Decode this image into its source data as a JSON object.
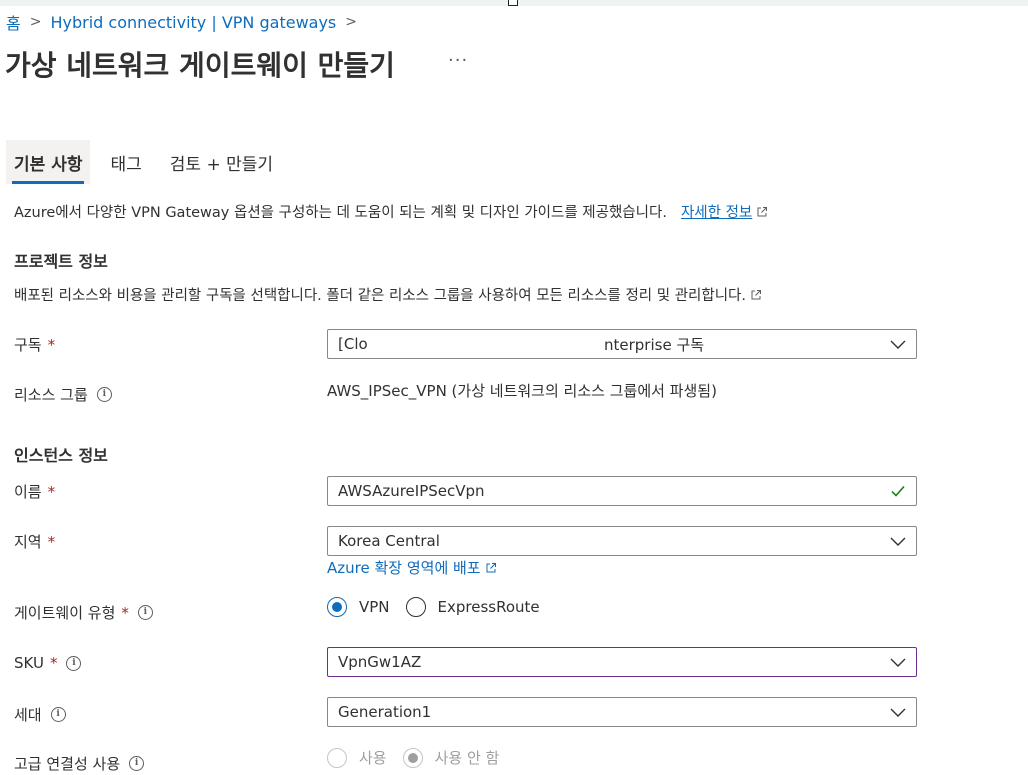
{
  "breadcrumb": {
    "home": "홈",
    "sep": ">",
    "item": "Hybrid connectivity | VPN gateways",
    "trailing_sep": ">"
  },
  "page": {
    "title": "가상 네트워크 게이트웨이 만들기",
    "more": "···"
  },
  "tabs": [
    {
      "label": "기본 사항",
      "active": true
    },
    {
      "label": "태그",
      "active": false
    },
    {
      "label": "검토 + 만들기",
      "active": false
    }
  ],
  "intro": {
    "text": "Azure에서 다양한 VPN Gateway 옵션을 구성하는 데 도움이 되는 계획 및 디자인 가이드를 제공했습니다.",
    "link": "자세한 정보"
  },
  "project": {
    "heading": "프로젝트 정보",
    "desc": "배포된 리소스와 비용을 관리할 구독을 선택합니다. 폴더 같은 리소스 그룹을 사용하여 모든 리소스를 정리 및 관리합니다.",
    "subscription_label": "구독",
    "subscription_value_start": "[Clo",
    "subscription_value_end": "nterprise 구독",
    "rg_label": "리소스 그룹",
    "rg_value": "AWS_IPSec_VPN (가상 네트워크의 리소스 그룹에서 파생됨)"
  },
  "instance": {
    "heading": "인스턴스 정보",
    "name_label": "이름",
    "name_value": "AWSAzureIPSecVpn",
    "region_label": "지역",
    "region_value": "Korea Central",
    "region_link": "Azure 확장 영역에 배포",
    "gw_type_label": "게이트웨이 유형",
    "gw_type_options": [
      {
        "label": "VPN",
        "selected": true
      },
      {
        "label": "ExpressRoute",
        "selected": false
      }
    ],
    "sku_label": "SKU",
    "sku_value": "VpnGw1AZ",
    "gen_label": "세대",
    "gen_value": "Generation1",
    "adv_label": "고급 연결성 사용",
    "adv_options": [
      {
        "label": "사용",
        "selected": false
      },
      {
        "label": "사용 안 함",
        "selected": true
      }
    ]
  },
  "required_marker": "*",
  "info_glyph": "i",
  "colors": {
    "accent": "#0f6cbd",
    "required": "#a4262c",
    "valid": "#107c10",
    "focus_border": "#6b2d91"
  }
}
